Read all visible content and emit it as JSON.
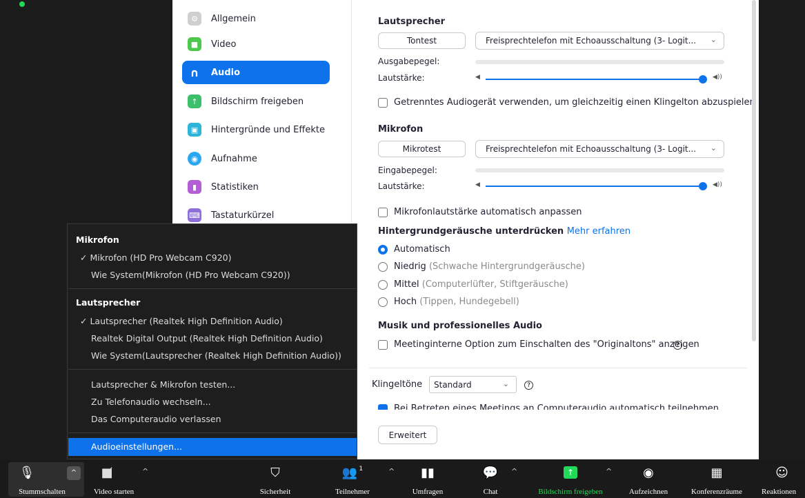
{
  "nav": {
    "items": [
      {
        "label": "Allgemein",
        "icon": "gear-icon",
        "color": "#cfcfcf"
      },
      {
        "label": "Video",
        "icon": "video-icon",
        "color": "#4cc94c"
      },
      {
        "label": "Audio",
        "icon": "headphones-icon",
        "color": "#0e72ed"
      },
      {
        "label": "Bildschirm freigeben",
        "icon": "share-screen-icon",
        "color": "#3cbf6a"
      },
      {
        "label": "Hintergründe und Effekte",
        "icon": "background-icon",
        "color": "#2db5d9"
      },
      {
        "label": "Aufnahme",
        "icon": "record-icon",
        "color": "#2aa7f0"
      },
      {
        "label": "Statistiken",
        "icon": "statistics-icon",
        "color": "#b45ed6"
      },
      {
        "label": "Tastaturkürzel",
        "icon": "keyboard-icon",
        "color": "#8c6fd8"
      }
    ],
    "active": "Audio"
  },
  "speaker": {
    "heading": "Lautsprecher",
    "test_button": "Tontest",
    "device": "Freisprechtelefon mit Echoausschaltung (3- Logit...",
    "output_level_label": "Ausgabepegel:",
    "volume_label": "Lautstärke:",
    "volume": 1.0
  },
  "separate_audio": {
    "label": "Getrenntes Audiogerät verwenden, um gleichzeitig einen Klingelton abzuspielen",
    "checked": false
  },
  "mic": {
    "heading": "Mikrofon",
    "test_button": "Mikrotest",
    "device": "Freisprechtelefon mit Echoausschaltung (3- Logit...",
    "input_level_label": "Eingabepegel:",
    "volume_label": "Lautstärke:",
    "volume": 1.0,
    "auto_adjust_label": "Mikrofonlautstärke automatisch anpassen",
    "auto_adjust_checked": false
  },
  "noise": {
    "heading": "Hintergrundgeräusche unterdrücken",
    "link": "Mehr erfahren",
    "options": [
      {
        "label": "Automatisch",
        "hint": "",
        "checked": true
      },
      {
        "label": "Niedrig",
        "hint": "(Schwache Hintergrundgeräusche)",
        "checked": false
      },
      {
        "label": "Mittel",
        "hint": "(Computerlüfter, Stiftgeräusche)",
        "checked": false
      },
      {
        "label": "Hoch",
        "hint": "(Tippen, Hundegebell)",
        "checked": false
      }
    ]
  },
  "music": {
    "heading": "Musik und professionelles Audio",
    "option_label": "Meetinginterne Option zum Einschalten des \"Originaltons\" anzeigen",
    "checked": false,
    "help": "?"
  },
  "ringtone": {
    "label": "Klingeltöne",
    "value": "Standard",
    "help": "?"
  },
  "auto_join": {
    "label": "Bei Betreten eines Meetings an Computeraudio automatisch teilnehmen",
    "checked": true
  },
  "advanced_button": "Erweitert",
  "popup": {
    "mic_heading": "Mikrofon",
    "mic_items": [
      {
        "label": "Mikrofon (HD Pro Webcam C920)",
        "checked": true
      },
      {
        "label": "Wie System(Mikrofon (HD Pro Webcam C920))",
        "checked": false
      }
    ],
    "speaker_heading": "Lautsprecher",
    "speaker_items": [
      {
        "label": "Lautsprecher (Realtek High Definition Audio)",
        "checked": true
      },
      {
        "label": "Realtek Digital Output (Realtek High Definition Audio)",
        "checked": false
      },
      {
        "label": "Wie System(Lautsprecher (Realtek High Definition Audio))",
        "checked": false
      }
    ],
    "actions": [
      "Lautsprecher & Mikrofon testen...",
      "Zu Telefonaudio wechseln...",
      "Das Computeraudio verlassen"
    ],
    "settings_item": "Audioeinstellungen...",
    "check_mark": "✓"
  },
  "toolbar": {
    "mute": "Stummschalten",
    "video": "Video starten",
    "security": "Sicherheit",
    "participants": "Teilnehmer",
    "participants_count": "1",
    "polls": "Umfragen",
    "chat": "Chat",
    "share": "Bildschirm freigeben",
    "record": "Aufzeichnen",
    "rooms": "Konferenzräume",
    "reactions": "Reaktionen",
    "share_color": "#23d959"
  }
}
